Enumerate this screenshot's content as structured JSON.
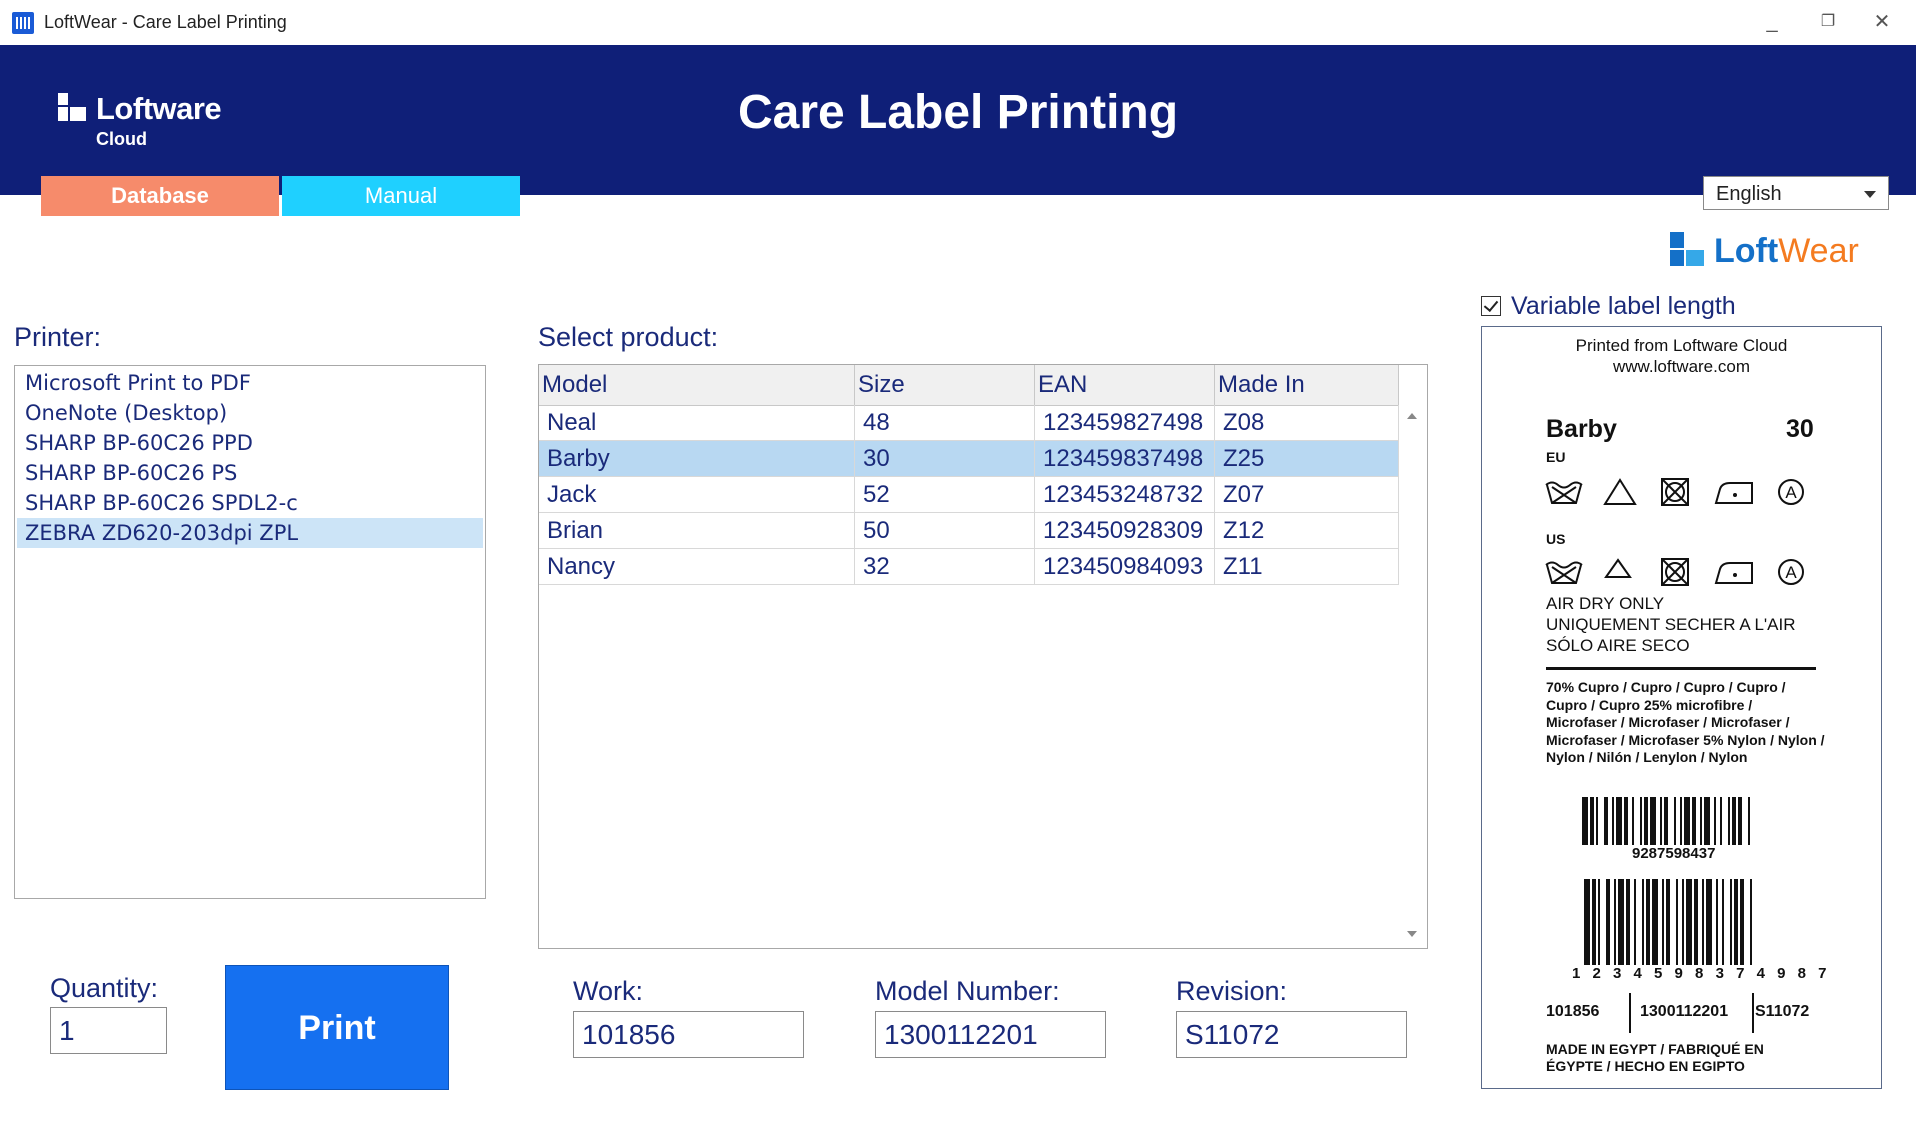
{
  "window": {
    "title": "LoftWear - Care Label Printing",
    "minimize": "_",
    "restore": "❐",
    "close": "✕"
  },
  "header": {
    "logo_name": "Loftware",
    "logo_sub": "Cloud",
    "title": "Care Label Printing",
    "tabs": [
      {
        "label": "Database",
        "active": true
      },
      {
        "label": "Manual",
        "active": false
      }
    ],
    "color_bg": "#0f1f78"
  },
  "language": {
    "selected": "English"
  },
  "brand": {
    "part1": "Loft",
    "part2": "Wear"
  },
  "printer": {
    "label": "Printer:",
    "items": [
      "Microsoft Print to PDF",
      "OneNote (Desktop)",
      "SHARP BP-60C26 PPD",
      "SHARP BP-60C26 PS",
      "SHARP BP-60C26 SPDL2-c",
      "ZEBRA ZD620-203dpi ZPL"
    ],
    "selected_index": 5
  },
  "products": {
    "label": "Select product:",
    "columns": [
      "Model",
      "Size",
      "EAN",
      "Made In"
    ],
    "rows": [
      [
        "Neal",
        "48",
        "123459827498",
        "Z08"
      ],
      [
        "Barby",
        "30",
        "123459837498",
        "Z25"
      ],
      [
        "Jack",
        "52",
        "123453248732",
        "Z07"
      ],
      [
        "Brian",
        "50",
        "123450928309",
        "Z12"
      ],
      [
        "Nancy",
        "32",
        "123450984093",
        "Z11"
      ]
    ],
    "selected_index": 1
  },
  "quantity": {
    "label": "Quantity:",
    "value": "1"
  },
  "print_button": {
    "label": "Print"
  },
  "work": {
    "label": "Work:",
    "value": "101856"
  },
  "model_number": {
    "label": "Model Number:",
    "value": "1300112201"
  },
  "revision": {
    "label": "Revision:",
    "value": "S11072"
  },
  "variable_length": {
    "label": "Variable label length",
    "checked": true
  },
  "preview": {
    "printed_from": "Printed from Loftware Cloud",
    "url": "www.loftware.com",
    "model": "Barby",
    "size": "30",
    "region_eu": "EU",
    "region_us": "US",
    "care_lines": [
      "AIR DRY ONLY",
      "UNIQUEMENT SECHER A L'AIR",
      "SÓLO AIRE SECO"
    ],
    "composition": "70%  Cupro / Cupro / Cupro / Cupro / Cupro / Cupro   25%  microfibre / Microfaser / Microfaser / Microfaser / Microfaser / Microfaser   5%  Nylon / Nylon / Nylon / Nilón / Lenylon / Nylon",
    "barcode1_text": "9287598437",
    "barcode2_text": "1 2 3 4 5 9 8 3 7 4 9 8 7",
    "work": "101856",
    "model_number": "1300112201",
    "revision": "S11072",
    "made_in": [
      "MADE IN EGYPT / FABRIQUÉ EN",
      "ÉGYPTE / HECHO EN EGIPTO"
    ]
  }
}
